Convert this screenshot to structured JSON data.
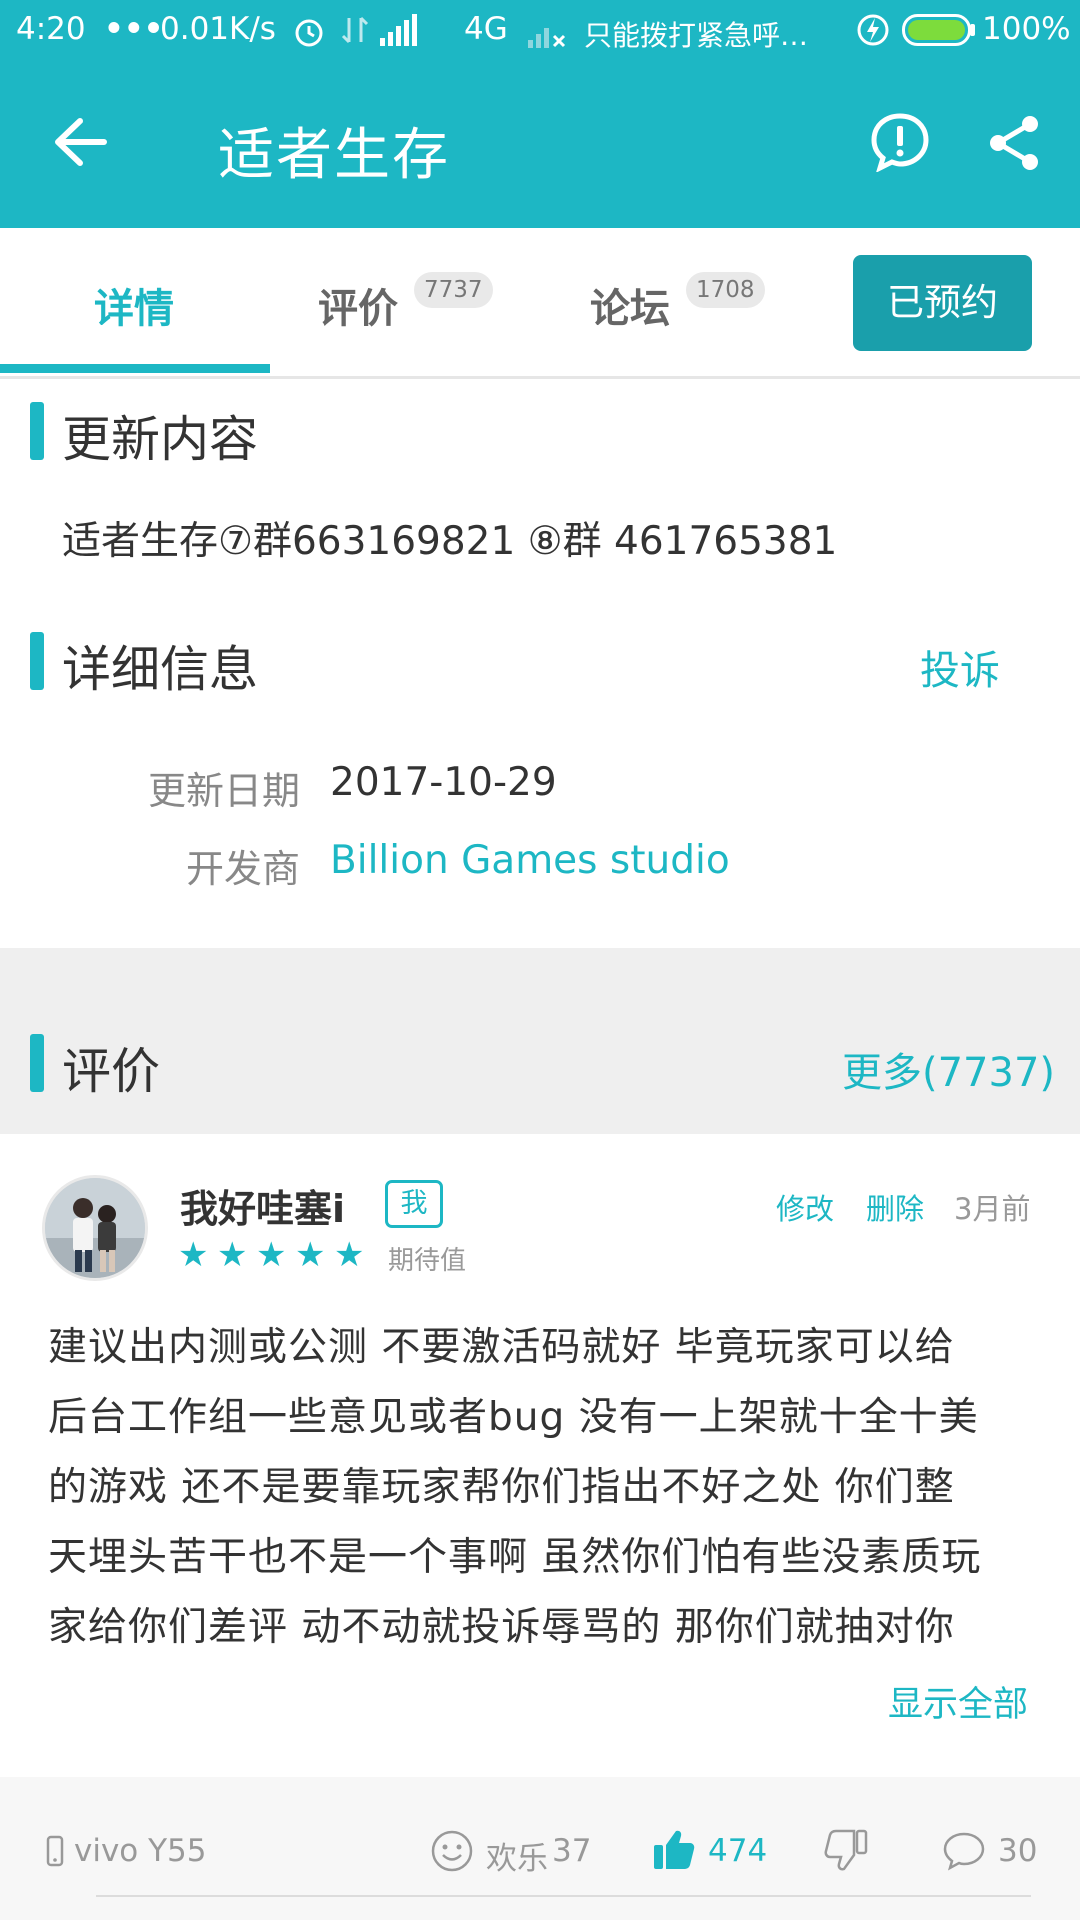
{
  "status_bar": {
    "time": "4:20",
    "net_speed": "0.01K/s",
    "network": "4G",
    "carrier": "只能拨打紧急呼…",
    "battery": "100%"
  },
  "header": {
    "title": "适者生存"
  },
  "tabs": [
    {
      "label": "详情"
    },
    {
      "label": "评价",
      "count": "7737"
    },
    {
      "label": "论坛",
      "count": "1708"
    }
  ],
  "reserve_button": "已预约",
  "update_section": {
    "title": "更新内容",
    "content": "适者生存⑦群663169821 ⑧群 461765381"
  },
  "detail_section": {
    "title": "详细信息",
    "complaint_link": "投诉",
    "rows": [
      {
        "label": "更新日期",
        "value": "2017-10-29"
      },
      {
        "label": "开发商",
        "value": "Billion Games studio"
      }
    ]
  },
  "review_section": {
    "title": "评价",
    "more_link": "更多(7737)"
  },
  "review": {
    "username": "我好哇塞i",
    "me_badge": "我",
    "rating": 5,
    "rating_label": "期待值",
    "edit": "修改",
    "delete": "删除",
    "time": "3月前",
    "lines": [
      "建议出内测或公测 不要激活码就好 毕竟玩家可以给",
      "后台工作组一些意见或者bug 没有一上架就十全十美",
      "的游戏 还不是要靠玩家帮你们指出不好之处 你们整",
      "天埋头苦干也不是一个事啊 虽然你们怕有些没素质玩",
      "家给你们差评 动不动就投诉辱骂的 那你们就抽对你"
    ],
    "show_all": "显示全部",
    "device": "vivo Y55",
    "fun_label": "欢乐",
    "fun_count": "37",
    "likes": "474",
    "comments": "30"
  },
  "colors": {
    "accent": "#1db7c4",
    "button": "#1a9fab"
  },
  "icons": [
    "back-arrow-icon",
    "report-icon",
    "share-icon",
    "star-icon",
    "phone-icon",
    "smile-icon",
    "thumbs-up-icon",
    "thumbs-down-icon",
    "comment-icon"
  ]
}
